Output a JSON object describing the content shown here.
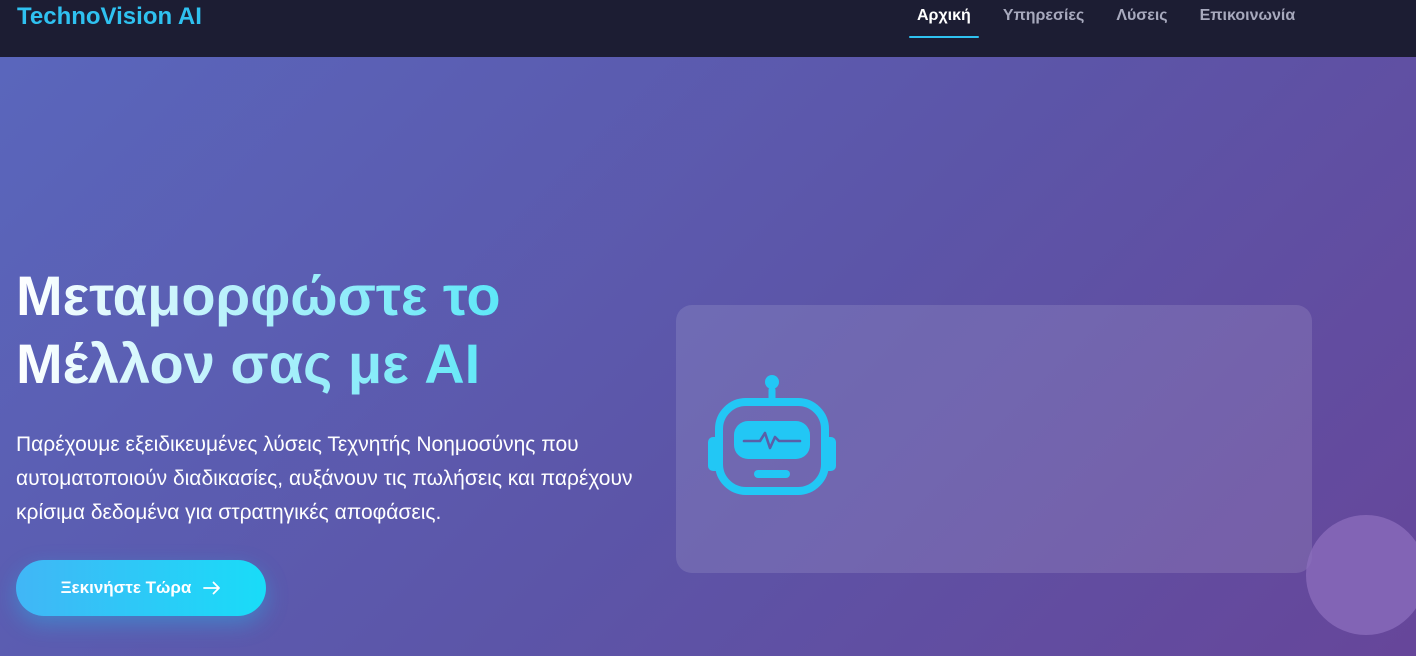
{
  "header": {
    "brand": "TechnoVision AI",
    "nav": [
      {
        "label": "Αρχική",
        "active": true
      },
      {
        "label": "Υπηρεσίες",
        "active": false
      },
      {
        "label": "Λύσεις",
        "active": false
      },
      {
        "label": "Επικοινωνία",
        "active": false
      }
    ]
  },
  "hero": {
    "title_line1": "Μεταμορφώστε το",
    "title_line2": "Μέλλον σας με AI",
    "subtitle": "Παρέχουμε εξειδικευμένες λύσεις Τεχνητής Νοημοσύνης που αυτοματοποιούν διαδικασίες, αυξάνουν τις πωλήσεις και παρέχουν κρίσιμα δεδομένα για στρατηγικές αποφάσεις.",
    "cta_label": "Ξεκινήστε Τώρα",
    "cta_icon": "arrow-right-icon",
    "visual_icon": "robot-icon"
  },
  "colors": {
    "accent": "#2fc1f0",
    "header_bg": "#1c1d33",
    "hero_gradient_start": "#5a67bd",
    "hero_gradient_end": "#66469a",
    "cta_start": "#41b6f6",
    "cta_end": "#19dcf8"
  }
}
